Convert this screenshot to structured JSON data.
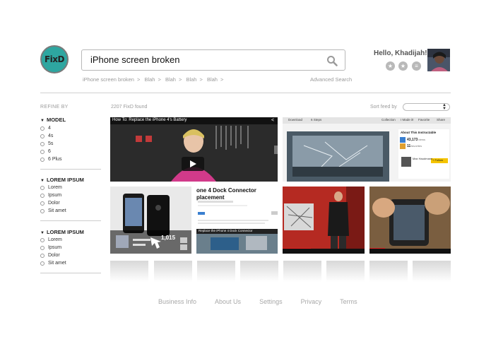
{
  "header": {
    "logo_text": "FixD",
    "search_value": "iPhone screen broken",
    "breadcrumb": [
      "iPhone screen broken",
      "Blah",
      "Blah",
      "Blah",
      "Blah"
    ],
    "advanced_search": "Advanced Search",
    "greeting": "Hello, Khadijah!",
    "user_icons": [
      "star-icon",
      "star-icon",
      "list-icon"
    ]
  },
  "sidebar": {
    "refine_label": "REFINE BY",
    "groups": [
      {
        "title": "MODEL",
        "options": [
          "4",
          "4s",
          "5s",
          "6",
          "6 Plus"
        ]
      },
      {
        "title": "LOREM IPSUM",
        "options": [
          "Lorem",
          "Ipsum",
          "Dolor",
          "Sit amet"
        ]
      },
      {
        "title": "LOREM IPSUM",
        "options": [
          "Lorem",
          "Ipsum",
          "Dolor",
          "Sit amet"
        ]
      }
    ]
  },
  "results": {
    "found": "2207 FixD found",
    "sort_label": "Sort feed by",
    "tiles": [
      {
        "type": "video",
        "title": "How To: Replace the iPhone 4's Battery"
      },
      {
        "type": "instructable",
        "header": "About This Instructable",
        "views": "43,173",
        "views_label": "views",
        "favorites": "11",
        "favorites_label": "favorites",
        "author": "Max Haudmann",
        "follow": "+ Follow",
        "toolbar": [
          "Download",
          "6 Steps",
          "Collection",
          "I Made it!",
          "Favorite",
          "Share"
        ]
      },
      {
        "type": "photo",
        "count": "1,015"
      },
      {
        "type": "article",
        "title": "one 4 Dock Connector placement",
        "subtitle": "Replace the iPhone 4 Dock Connector"
      },
      {
        "type": "video",
        "title": ""
      },
      {
        "type": "video",
        "title": ""
      }
    ]
  },
  "footer": {
    "links": [
      "Business Info",
      "About Us",
      "Settings",
      "Privacy",
      "Terms"
    ]
  },
  "colors": {
    "logo_teal": "#2ea6a0",
    "accent_red": "#cc2a2a"
  }
}
